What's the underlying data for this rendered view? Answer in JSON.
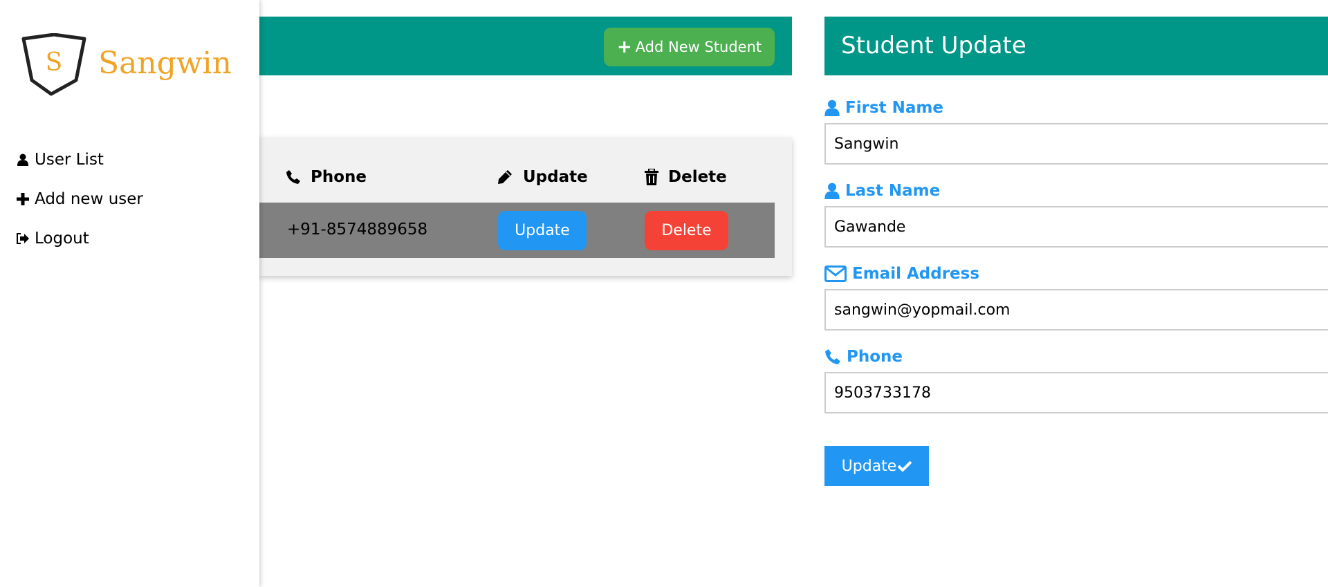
{
  "brand": {
    "letter": "S",
    "name": "Sangwin",
    "color": "#f0a426"
  },
  "sidebar": {
    "items": [
      {
        "label": "User List",
        "icon": "user-icon"
      },
      {
        "label": "Add new user",
        "icon": "plus-icon"
      },
      {
        "label": "Logout",
        "icon": "sign-out-icon"
      }
    ]
  },
  "list_panel": {
    "add_button_label": "Add New Student",
    "columns": [
      {
        "label": "Phone",
        "icon": "phone-icon"
      },
      {
        "label": "Update",
        "icon": "pencil-icon"
      },
      {
        "label": "Delete",
        "icon": "trash-icon"
      }
    ],
    "rows": [
      {
        "phone": "+91-8574889658",
        "update_label": "Update",
        "delete_label": "Delete"
      }
    ]
  },
  "form_panel": {
    "title": "Student Update",
    "fields": [
      {
        "label": "First Name",
        "icon": "user-icon",
        "value": "Sangwin"
      },
      {
        "label": "Last Name",
        "icon": "user-icon",
        "value": "Gawande"
      },
      {
        "label": "Email Address",
        "icon": "envelope-icon",
        "value": "sangwin@yopmail.com"
      },
      {
        "label": "Phone",
        "icon": "phone-icon",
        "value": "9503733178"
      }
    ],
    "submit_label": "Update"
  },
  "colors": {
    "teal_header": "#009688",
    "green_button": "#4caf50",
    "blue_button": "#2196f3",
    "red_button": "#f44336",
    "label_blue": "#2196f3",
    "row_gray": "#808080"
  }
}
